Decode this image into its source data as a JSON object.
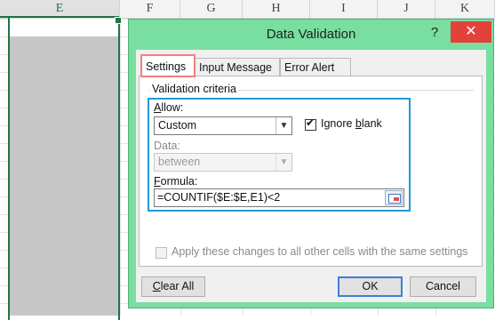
{
  "sheet": {
    "columns": [
      "E",
      "F",
      "G",
      "H",
      "I",
      "J",
      "K"
    ]
  },
  "dialog": {
    "title": "Data Validation",
    "help_glyph": "?",
    "close_glyph": "✕",
    "tabs": [
      {
        "label": "Settings",
        "active": true
      },
      {
        "label": "Input Message",
        "active": false
      },
      {
        "label": "Error Alert",
        "active": false
      }
    ],
    "group_label": "Validation criteria",
    "allow": {
      "label_pre": "",
      "label_key": "A",
      "label_post": "llow:",
      "value": "Custom"
    },
    "ignore_blank": {
      "label_pre": "Ignore ",
      "label_key": "b",
      "label_post": "lank",
      "checked": true
    },
    "data": {
      "label": "Data:",
      "value": "between"
    },
    "formula": {
      "label_pre": "",
      "label_key": "F",
      "label_post": "ormula:",
      "value": "=COUNTIF($E:$E,E1)<2"
    },
    "apply_all": {
      "label": "Apply these changes to all other cells with the same settings",
      "checked": false
    },
    "buttons": {
      "clear_all_key": "C",
      "clear_all_rest": "lear All",
      "ok": "OK",
      "cancel": "Cancel"
    },
    "colors": {
      "frame": "#78dfa0",
      "close": "#e3423a",
      "highlight_tab": "#f08080",
      "highlight_box": "#1f9bd6"
    }
  }
}
